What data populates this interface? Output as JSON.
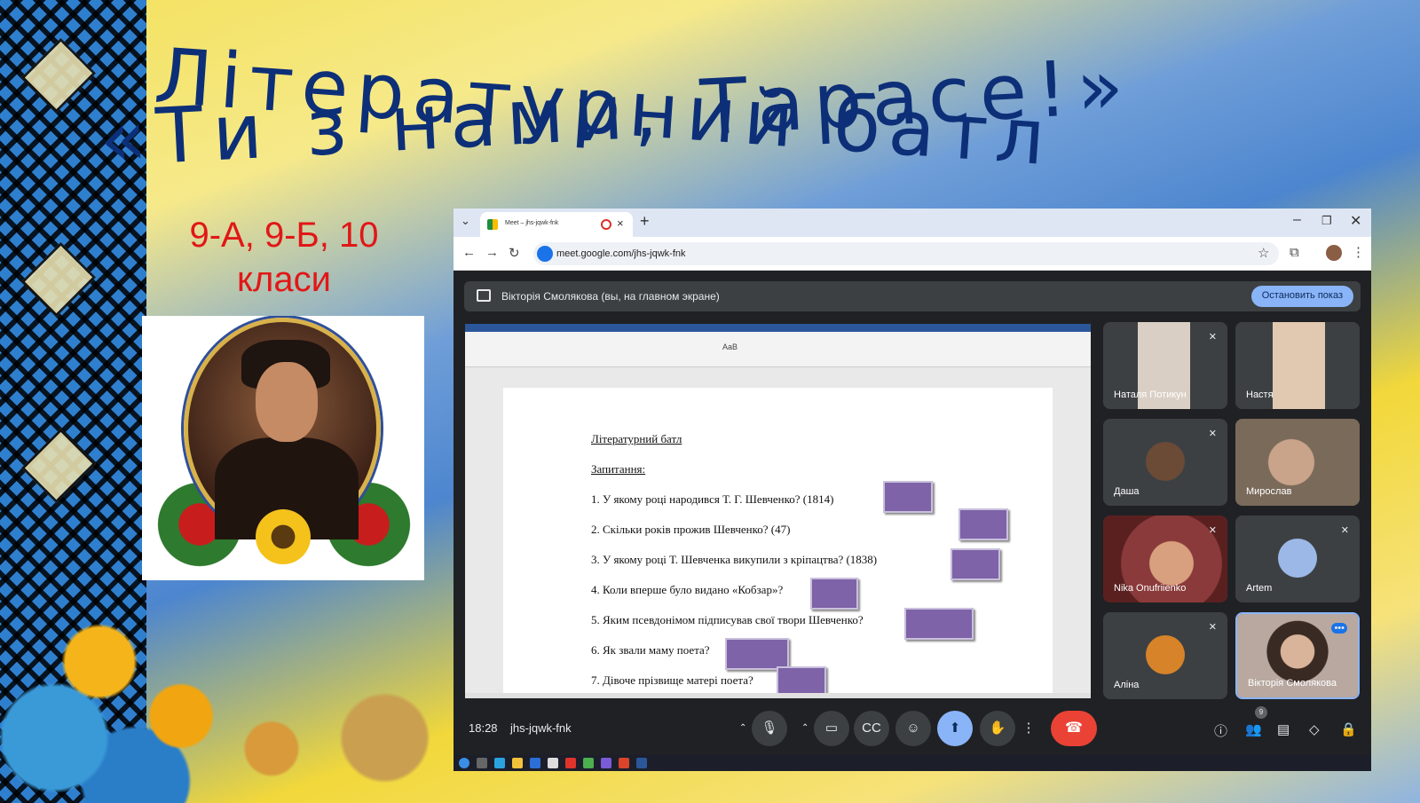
{
  "slide": {
    "title_line1": "Літературний батл",
    "title_line2": "«Ти з нами, Тарасе!»",
    "classes_line1": "9-А, 9-Б, 10",
    "classes_line2": "класи"
  },
  "browser": {
    "tab_title": "Meet – jhs-jqwk-fnk",
    "url": "meet.google.com/jhs-jqwk-fnk"
  },
  "meet": {
    "presenting_text": "Вікторія Смолякова (вы, на главном экране)",
    "stop_button": "Остановить показ",
    "time": "18:28",
    "code": "jhs-jqwk-fnk",
    "people_count": "9",
    "participants": [
      "Наталя Потикун",
      "Настя",
      "Даша",
      "Мирослав",
      "Nika Onufriienko",
      "Artem",
      "Аліна",
      "Вікторія Смолякова"
    ]
  },
  "document": {
    "heading": "Літературний батл",
    "subheading": "Запитання:",
    "questions": [
      "1. У якому році народився Т. Г. Шевченко? (1814)",
      "2. Скільки років прожив Шевченко? (47)",
      "3. У якому році Т. Шевченка викупили з кріпацтва? (1838)",
      "4. Коли вперше було видано «Кобзар»?",
      "5. Яким псевдонімом підписував свої твори Шевченко?",
      "6. Як звали маму поета?",
      "7. Дівоче прізвище матері поета?"
    ],
    "ribbon_style": "AaB"
  },
  "icons": [
    "tab-dropdown-icon",
    "record-icon",
    "close-icon",
    "plus-icon",
    "minimize-icon",
    "maximize-icon",
    "back-icon",
    "forward-icon",
    "reload-icon",
    "star-icon",
    "extensions-icon",
    "menu-icon",
    "present-icon",
    "mic-off-icon",
    "mic-icon",
    "camera-icon",
    "captions-icon",
    "emoji-icon",
    "present-now-icon",
    "raise-hand-icon",
    "more-icon",
    "leave-call-icon",
    "info-icon",
    "people-icon",
    "chat-icon",
    "activities-icon",
    "host-controls-icon"
  ],
  "colors": {
    "title": "#0d2f78",
    "classes": "#e11717",
    "answer_box": "#7e63a8",
    "stop_button": "#8ab4f8",
    "leave": "#ea4335"
  }
}
